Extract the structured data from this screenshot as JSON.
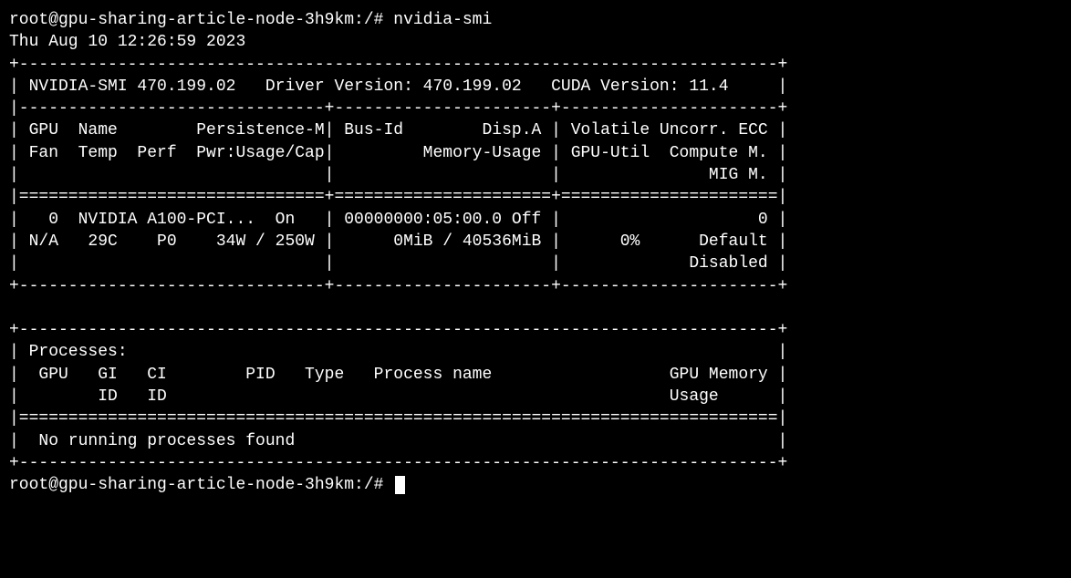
{
  "prompt1": "root@gpu-sharing-article-node-3h9km:/# nvidia-smi",
  "timestamp": "Thu Aug 10 12:26:59 2023",
  "hr_top": "+-----------------------------------------------------------------------------+",
  "smi_header": "| NVIDIA-SMI 470.199.02   Driver Version: 470.199.02   CUDA Version: 11.4     |",
  "hr_sep3": "|-------------------------------+----------------------+----------------------+",
  "col_h1": "| GPU  Name        Persistence-M| Bus-Id        Disp.A | Volatile Uncorr. ECC |",
  "col_h2": "| Fan  Temp  Perf  Pwr:Usage/Cap|         Memory-Usage | GPU-Util  Compute M. |",
  "col_h3": "|                               |                      |               MIG M. |",
  "hr_eq3": "|===============================+======================+======================|",
  "gpu_r1": "|   0  NVIDIA A100-PCI...  On   | 00000000:05:00.0 Off |                    0 |",
  "gpu_r2": "| N/A   29C    P0    34W / 250W |      0MiB / 40536MiB |      0%      Default |",
  "gpu_r3": "|                               |                      |             Disabled |",
  "hr_bot3": "+-------------------------------+----------------------+----------------------+",
  "blank": "                                                                               ",
  "proc_top": "+-----------------------------------------------------------------------------+",
  "proc_h1": "| Processes:                                                                  |",
  "proc_h2": "|  GPU   GI   CI        PID   Type   Process name                  GPU Memory |",
  "proc_h3": "|        ID   ID                                                   Usage      |",
  "proc_eq": "|=============================================================================|",
  "proc_none": "|  No running processes found                                                 |",
  "proc_bot": "+-----------------------------------------------------------------------------+",
  "prompt2": "root@gpu-sharing-article-node-3h9km:/# "
}
